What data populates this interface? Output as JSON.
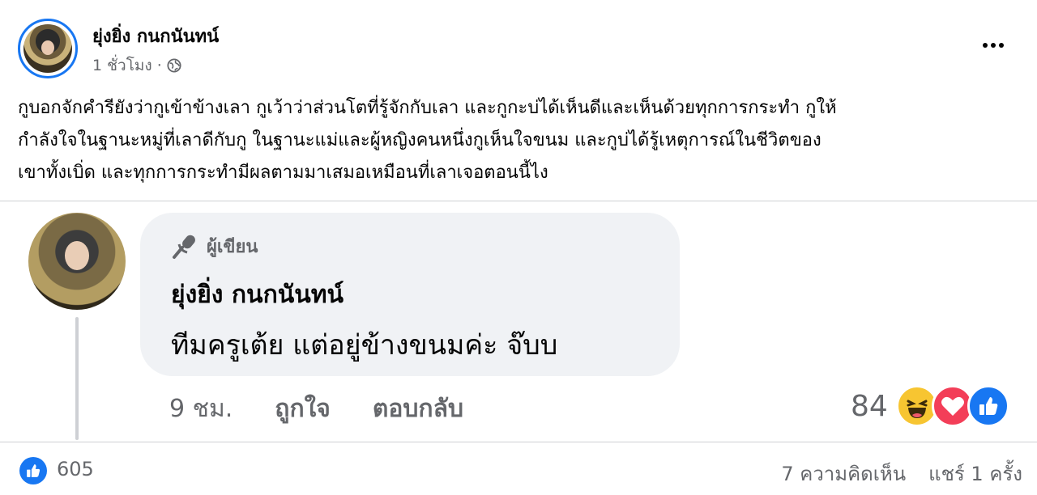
{
  "post": {
    "author": "ยุ่งยิ่ง กนกนันทน์",
    "time": "1 ชั่วโมง",
    "separator": "·",
    "privacy_icon": "globe-icon",
    "text_lines": [
      "กูบอกจักคำรียังว่ากูเข้าข้างเลา กูเว้าว่าส่วนโตที่รู้จักกับเลา และกูกะบ่ได้เห็นดีและเห็นด้วยทุกการกระทำ กูให้",
      "กำลังใจในฐานะหมู่ที่เลาดีกับกู ในฐานะแม่และผู้หญิงคนหนึ่งกูเห็นใจขนม และกูบ่ได้รู้เหตุการณ์ในชีวิตของ",
      "เขาทั้งเบิ่ด และทุกการกระทำมีผลตามมาเสมอเหมือนที่เลาเจอตอนนี้ไง"
    ]
  },
  "comment": {
    "badge_label": "ผู้เขียน",
    "badge_icon": "microphone-icon",
    "author": "ยุ่งยิ่ง กนกนันทน์",
    "text": "ทีมครูเต้ย แต่อยู่ข้างขนมค่ะ จ๊บบ",
    "time": "9 ชม.",
    "like_label": "ถูกใจ",
    "reply_label": "ตอบกลับ",
    "reaction_count": "84",
    "reactions": [
      "haha-icon",
      "love-icon",
      "like-icon"
    ]
  },
  "footer": {
    "like_count": "605",
    "comments": "7 ความคิดเห็น",
    "shares": "แชร์ 1 ครั้ง"
  },
  "colors": {
    "accent": "#1877f2",
    "secondary_text": "#65676b",
    "bubble": "#f0f2f5",
    "love": "#f33e58",
    "haha": "#f7c531"
  }
}
